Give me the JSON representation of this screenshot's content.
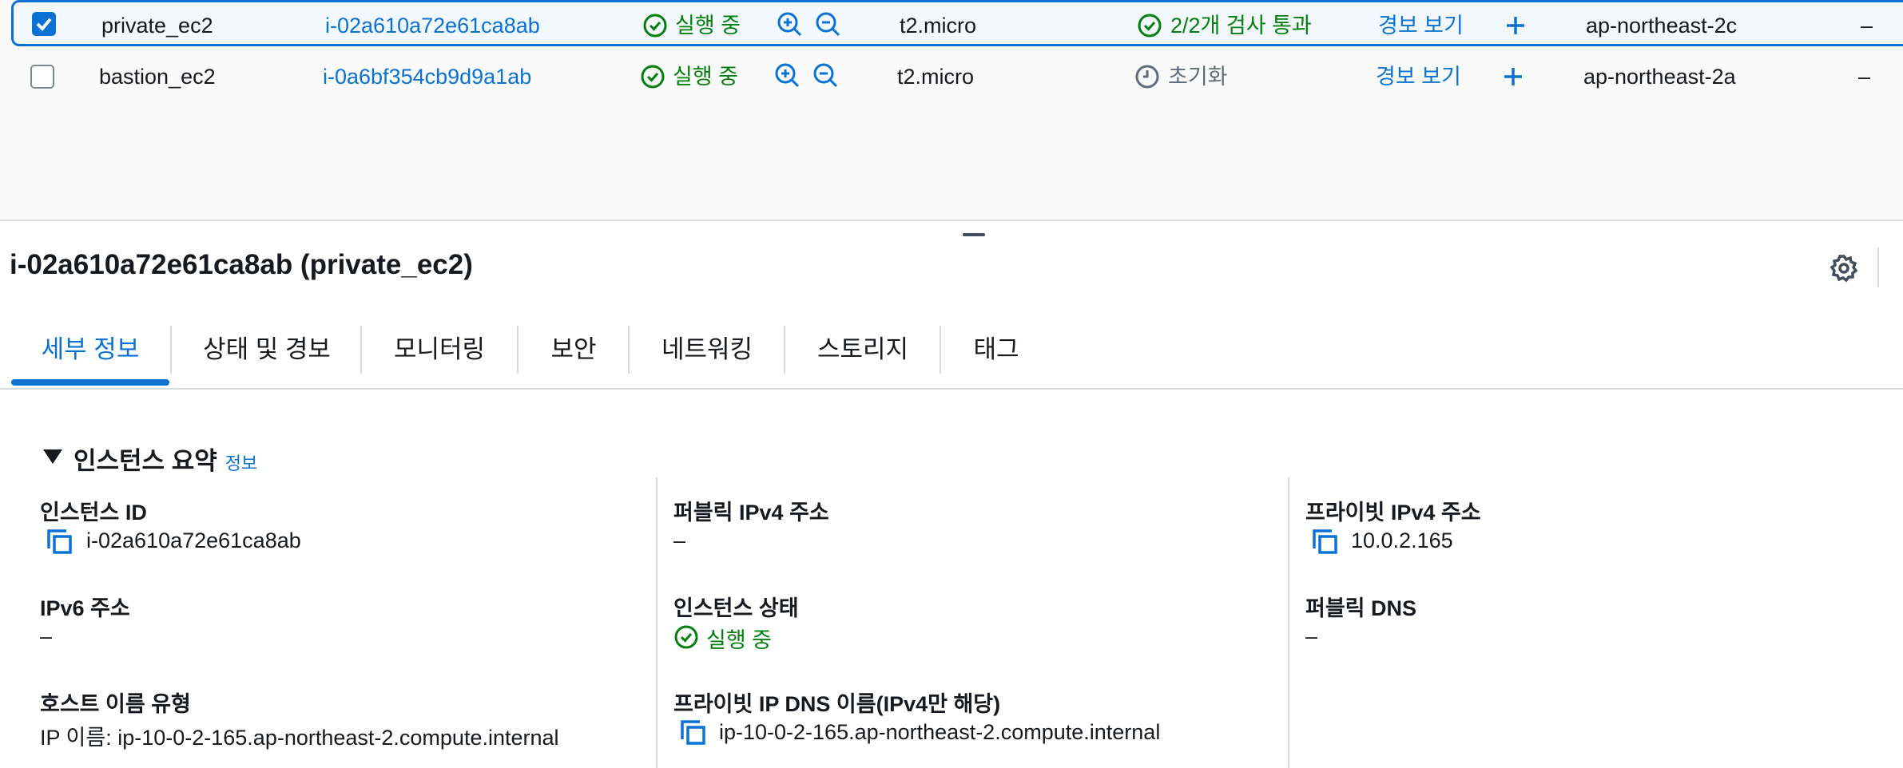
{
  "rows": [
    {
      "selected": true,
      "name": "private_ec2",
      "instance_id": "i-02a610a72e61ca8ab",
      "state": "실행 중",
      "type": "t2.micro",
      "status_check": "2/2개 검사 통과",
      "alarm": "경보 보기",
      "az": "ap-northeast-2c",
      "dash": "–"
    },
    {
      "selected": false,
      "name": "bastion_ec2",
      "instance_id": "i-0a6bf354cb9d9a1ab",
      "state": "실행 중",
      "type": "t2.micro",
      "status_check": "초기화",
      "alarm": "경보 보기",
      "az": "ap-northeast-2a",
      "dash": "–"
    }
  ],
  "detail": {
    "title": "i-02a610a72e61ca8ab (private_ec2)",
    "tabs": [
      "세부 정보",
      "상태 및 경보",
      "모니터링",
      "보안",
      "네트워킹",
      "스토리지",
      "태그"
    ],
    "active_tab": "세부 정보",
    "section_title": "인스턴스 요약",
    "info_link": "정보",
    "fields": {
      "instance_id_label": "인스턴스 ID",
      "instance_id_value": "i-02a610a72e61ca8ab",
      "public_ipv4_label": "퍼블릭 IPv4 주소",
      "public_ipv4_value": "–",
      "private_ipv4_label": "프라이빗 IPv4 주소",
      "private_ipv4_value": "10.0.2.165",
      "ipv6_label": "IPv6 주소",
      "ipv6_value": "–",
      "instance_state_label": "인스턴스 상태",
      "instance_state_value": "실행 중",
      "public_dns_label": "퍼블릭 DNS",
      "public_dns_value": "–",
      "hostname_type_label": "호스트 이름 유형",
      "hostname_type_value": "IP 이름: ip-10-0-2-165.ap-northeast-2.compute.internal",
      "private_dns_label": "프라이빗 IP DNS 이름(IPv4만 해당)",
      "private_dns_value": "ip-10-0-2-165.ap-northeast-2.compute.internal"
    }
  },
  "colors": {
    "link": "#0972d3",
    "success": "#037f0c",
    "muted": "#5f6b7a",
    "divider": "#d5dbdb"
  },
  "icons": [
    "check-circle-icon",
    "zoom-in-icon",
    "zoom-out-icon",
    "plus-icon",
    "clock-icon",
    "copy-icon",
    "gear-icon",
    "caret-down-icon"
  ]
}
